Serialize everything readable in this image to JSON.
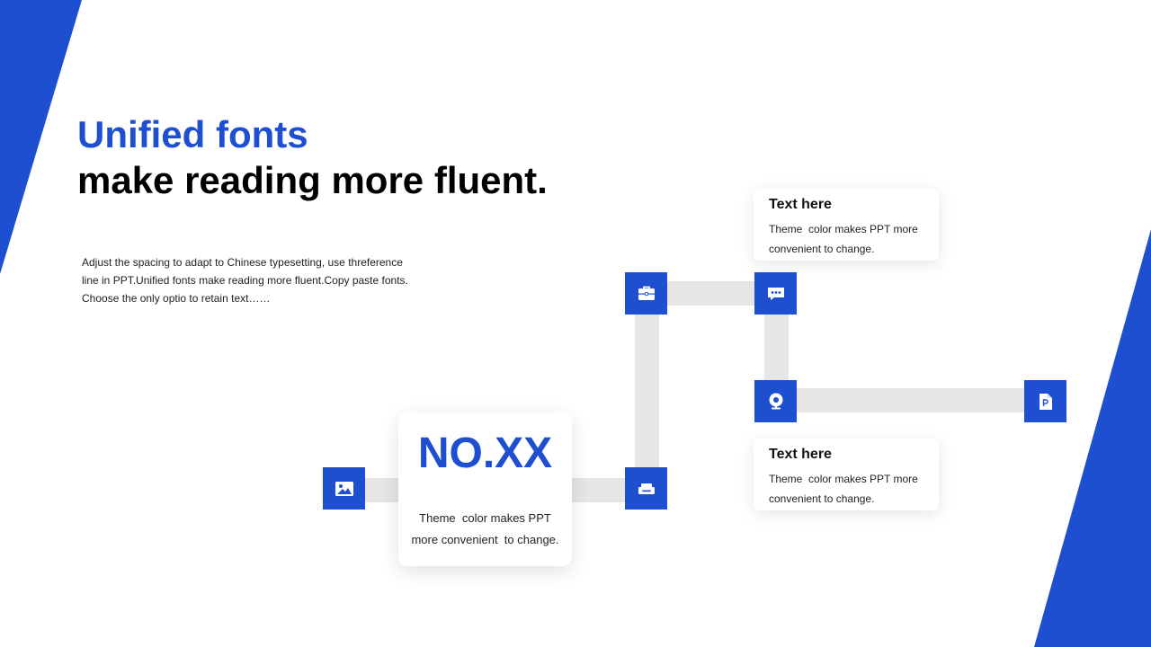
{
  "colors": {
    "accent": "#1f4fd1",
    "connector": "#e6e6e6",
    "text": "#222222",
    "background": "#ffffff"
  },
  "heading": {
    "line1": "Unified fonts",
    "line2": "make reading more fluent."
  },
  "intro": {
    "lines": [
      "Adjust the spacing to adapt to Chinese typesetting, use threference",
      "line in PPT.Unified fonts make reading more fluent.Copy paste fonts.",
      "Choose the only optio to retain text……"
    ]
  },
  "main_card": {
    "number": "NO.XX",
    "description": "Theme  color makes PPT\nmore convenient  to change."
  },
  "cards": [
    {
      "title": "Text here",
      "description": "Theme  color makes PPT more convenient to change."
    },
    {
      "title": "Text here",
      "description": "Theme  color makes PPT more convenient to change."
    }
  ],
  "icons": {
    "image": "image-icon",
    "sofa": "sofa-icon",
    "briefcase": "briefcase-icon",
    "chat": "chat-icon",
    "webcam": "webcam-icon",
    "document": "document-icon"
  }
}
